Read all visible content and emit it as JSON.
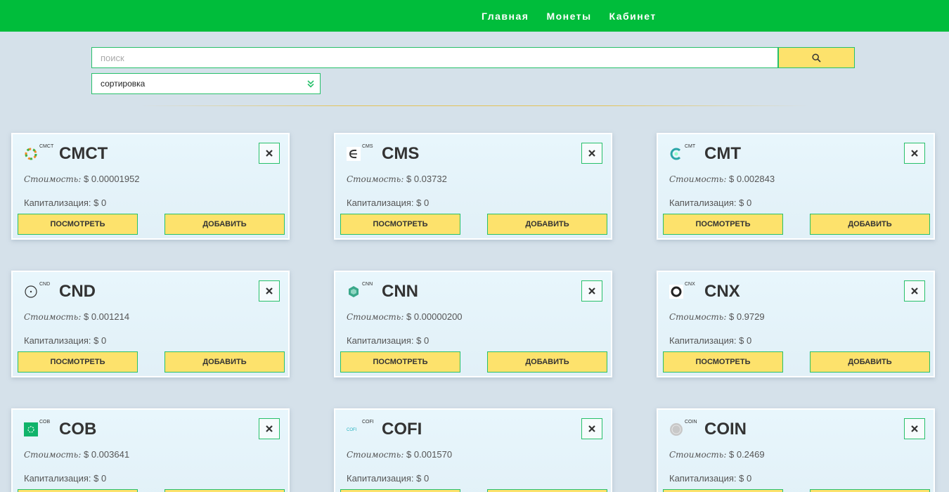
{
  "nav": {
    "items": [
      "Главная",
      "Монеты",
      "Кабинет"
    ]
  },
  "search": {
    "placeholder": "поиск",
    "button_icon": "search-icon"
  },
  "sort": {
    "label": "сортировка",
    "icon": "double-chevron-down-icon"
  },
  "labels": {
    "price_prefix": "Стоимость:",
    "cap_prefix": "Капитализация:",
    "view": "ПОСМОТРЕТЬ",
    "add": "ДОБАВИТЬ"
  },
  "colors": {
    "header": "#00bd3b",
    "button": "#fde26c",
    "border": "#27c06a",
    "background": "#d5e1ea"
  },
  "coins": [
    {
      "symbol": "CMCT",
      "price": "$ 0.00001952",
      "cap": "$ 0",
      "logo": "cmct-logo-icon"
    },
    {
      "symbol": "CMS",
      "price": "$ 0.03732",
      "cap": "$ 0",
      "logo": "cms-logo-icon"
    },
    {
      "symbol": "CMT",
      "price": "$ 0.002843",
      "cap": "$ 0",
      "logo": "cmt-logo-icon"
    },
    {
      "symbol": "CND",
      "price": "$ 0.001214",
      "cap": "$ 0",
      "logo": "cnd-logo-icon"
    },
    {
      "symbol": "CNN",
      "price": "$ 0.00000200",
      "cap": "$ 0",
      "logo": "cnn-logo-icon"
    },
    {
      "symbol": "CNX",
      "price": "$ 0.9729",
      "cap": "$ 0",
      "logo": "cnx-logo-icon"
    },
    {
      "symbol": "COB",
      "price": "$ 0.003641",
      "cap": "$ 0",
      "logo": "cob-logo-icon"
    },
    {
      "symbol": "COFI",
      "price": "$ 0.001570",
      "cap": "$ 0",
      "logo": "cofi-logo-icon"
    },
    {
      "symbol": "COIN",
      "price": "$ 0.2469",
      "cap": "$ 0",
      "logo": "coin-logo-icon"
    }
  ]
}
